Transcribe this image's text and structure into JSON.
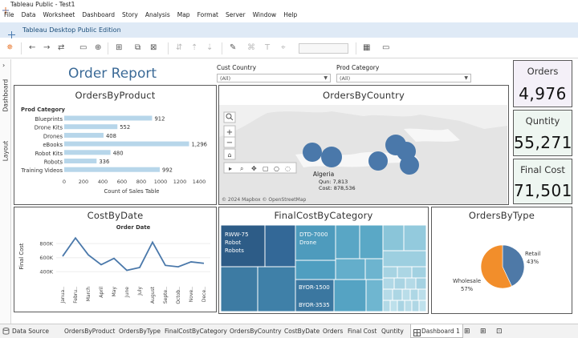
{
  "window": {
    "title": "Tableau Public - Test1"
  },
  "menu": [
    "File",
    "Data",
    "Worksheet",
    "Dashboard",
    "Story",
    "Analysis",
    "Map",
    "Format",
    "Server",
    "Window",
    "Help"
  ],
  "edition": {
    "label": "Tableau Desktop Public Edition"
  },
  "sidebar": {
    "tabs": [
      "Dashboard",
      "Layout"
    ]
  },
  "dashboard": {
    "title": "Order Report",
    "filters": [
      {
        "label": "Cust Country",
        "value": "(All)"
      },
      {
        "label": "Prod Category",
        "value": "(All)"
      }
    ],
    "cards": [
      {
        "label": "Orders",
        "value": "4,976",
        "bg": "#f4f0f8"
      },
      {
        "label": "Quntity",
        "value": "55,271",
        "bg": "#eef6f1"
      },
      {
        "label": "Final Cost",
        "value": "71,501",
        "bg": "#eef6f1"
      }
    ]
  },
  "orders_by_product": {
    "title": "OrdersByProduct",
    "chart_data": {
      "type": "bar",
      "orientation": "horizontal",
      "title": "OrdersByProduct",
      "category_header": "Prod Category",
      "categories": [
        "Blueprints",
        "Drone Kits",
        "Drones",
        "eBooks",
        "Robot Kits",
        "Robots",
        "Training Videos"
      ],
      "values": [
        912,
        552,
        408,
        1296,
        480,
        336,
        992
      ],
      "value_labels": [
        "912",
        "552",
        "408",
        "1,296",
        "480",
        "336",
        "992"
      ],
      "xlabel": "Count of Sales Table",
      "xticks": [
        "0",
        "200",
        "400",
        "600",
        "800",
        "1000",
        "1200",
        "1400"
      ],
      "xlim": [
        0,
        1400
      ],
      "bar_color": "#b7d6ea"
    }
  },
  "orders_by_country": {
    "title": "OrdersByCountry",
    "tooltip": {
      "country": "Algeria",
      "qun": "Qun: 7,813",
      "cost": "Cost: 878,536"
    },
    "attribution": "© 2024 Mapbox © OpenStreetMap",
    "bubble_color": "#4a78aa",
    "map_controls": [
      "search-icon",
      "zoom-in-icon",
      "zoom-out-icon",
      "reset-icon"
    ],
    "map_tools": [
      "play-icon",
      "zoom-area-icon",
      "pan-icon",
      "rect-select-icon",
      "radial-select-icon",
      "lasso-icon"
    ]
  },
  "cost_by_date": {
    "title": "CostByDate",
    "chart_data": {
      "type": "line",
      "title": "Order Date",
      "ylabel": "Final Cost",
      "categories": [
        "Janua..",
        "Febru..",
        "March",
        "April",
        "May",
        "June",
        "July",
        "August",
        "Septe..",
        "Octob..",
        "Nove..",
        "Dece.."
      ],
      "values": [
        620000,
        880000,
        640000,
        500000,
        590000,
        420000,
        460000,
        820000,
        490000,
        470000,
        540000,
        520000
      ],
      "yticks": [
        "400K",
        "600K",
        "800K"
      ],
      "ylim": [
        300000,
        950000
      ],
      "line_color": "#4a78aa"
    }
  },
  "final_cost_by_category": {
    "title": "FinalCostByCategory",
    "labels": [
      {
        "title": "RWW-75",
        "sub1": "Robot",
        "sub2": "Robots"
      },
      {
        "title": "DTD-7000",
        "sub1": "Drone"
      },
      {
        "title": "BYOR-1500"
      },
      {
        "title": "BYOR-3535"
      }
    ],
    "palette": [
      "#2d5c87",
      "#3d7ba3",
      "#4e9bbd",
      "#64aecb",
      "#8ac5d9",
      "#a6d3e2"
    ]
  },
  "orders_by_type": {
    "title": "OrdersByType",
    "chart_data": {
      "type": "pie",
      "title": "OrdersByType",
      "slices": [
        {
          "label": "Retail",
          "value": 43,
          "pct_label": "43%",
          "color": "#4e79a7"
        },
        {
          "label": "Wholesale",
          "value": 57,
          "pct_label": "57%",
          "color": "#f28e2b"
        }
      ]
    }
  },
  "sheet_tabs": {
    "data_source": "Data Source",
    "tabs": [
      "OrdersByProduct",
      "OrdersByType",
      "FinalCostByCategory",
      "OrdersByCountry",
      "CostByDate",
      "Orders",
      "Final Cost",
      "Quntity",
      "Dashboard 1"
    ],
    "active": "Dashboard 1"
  }
}
